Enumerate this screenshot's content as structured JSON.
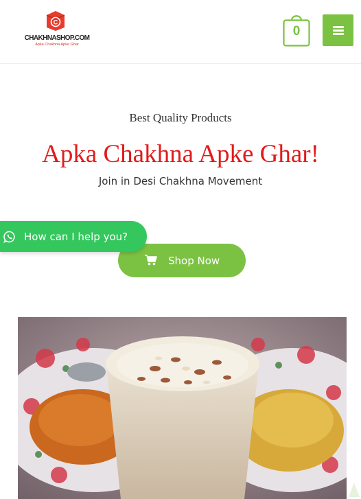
{
  "header": {
    "logo": {
      "name": "CHAKHNASHOP.COM",
      "tagline": "Apka Chakhna Apke Ghar"
    },
    "cart": {
      "count": "0",
      "icon": "shopping-bag-icon"
    },
    "menu": {
      "icon": "hamburger-icon"
    }
  },
  "hero": {
    "subtitle": "Best Quality Products",
    "headline": "Apka Chakhna Apke Ghar!",
    "tagline": "Join in Desi Chakhna Movement",
    "cta_label": "Shop Now",
    "cta_icon": "cart-icon"
  },
  "whatsapp": {
    "label": "How can I help you?",
    "icon": "whatsapp-icon"
  },
  "colors": {
    "accent": "#7cc242",
    "headline": "#e31b1b",
    "whatsapp": "#34c75e"
  }
}
